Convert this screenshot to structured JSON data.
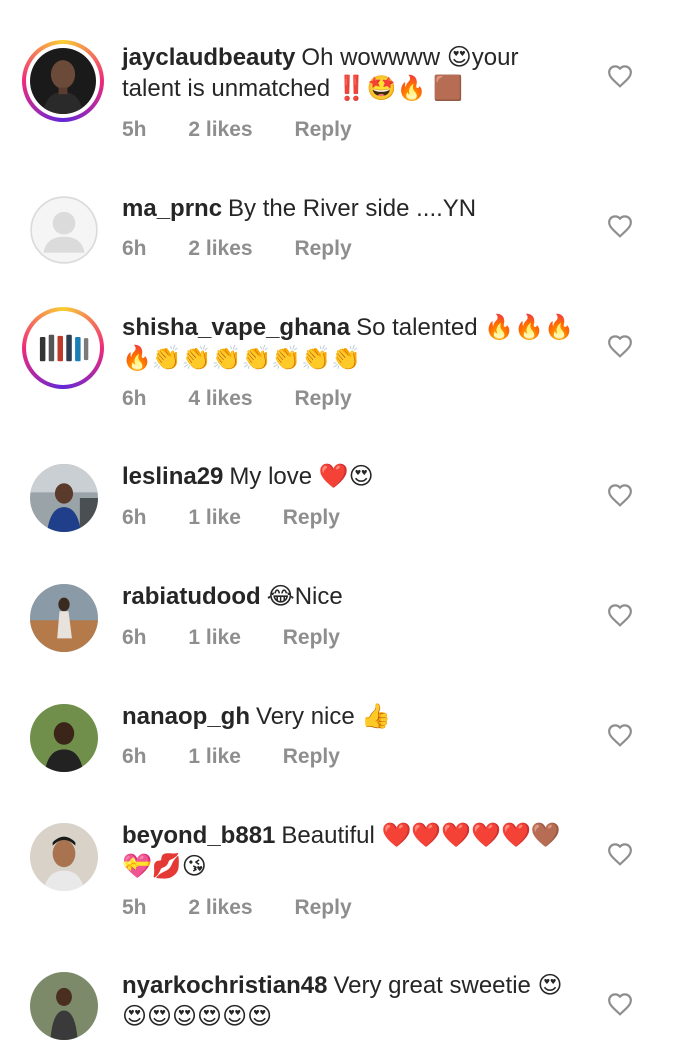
{
  "comments": [
    {
      "username": "jayclaudbeauty",
      "text": "Oh wowwww 😍your talent is unmatched ‼️🤩🔥 🟫",
      "time": "5h",
      "likes": "2 likes",
      "reply": "Reply",
      "avatar_icon": "avatar-photo-man",
      "story_ring": true
    },
    {
      "username": "ma_prnc",
      "text": "By the River side ....YN",
      "time": "6h",
      "likes": "2 likes",
      "reply": "Reply",
      "avatar_icon": "default-avatar-icon",
      "story_ring": false
    },
    {
      "username": "shisha_vape_ghana",
      "text": "So talented 🔥🔥🔥🔥👏👏👏👏👏👏👏",
      "time": "6h",
      "likes": "4 likes",
      "reply": "Reply",
      "avatar_icon": "avatar-vape-products",
      "story_ring": true
    },
    {
      "username": "leslina29",
      "text": "My love ❤️😍",
      "time": "6h",
      "likes": "1 like",
      "reply": "Reply",
      "avatar_icon": "avatar-photo-woman-car",
      "story_ring": false
    },
    {
      "username": "rabiatudood",
      "text": "😂Nice",
      "time": "6h",
      "likes": "1 like",
      "reply": "Reply",
      "avatar_icon": "avatar-photo-woman-outdoor",
      "story_ring": false
    },
    {
      "username": "nanaop_gh",
      "text": "Very nice 👍",
      "time": "6h",
      "likes": "1 like",
      "reply": "Reply",
      "avatar_icon": "avatar-photo-woman-greenery",
      "story_ring": false
    },
    {
      "username": "beyond_b881",
      "text": "Beautiful ❤️❤️❤️❤️❤️🤎💝💋😘",
      "time": "5h",
      "likes": "2 likes",
      "reply": "Reply",
      "avatar_icon": "avatar-photo-man-young",
      "story_ring": false
    },
    {
      "username": "nyarkochristian48",
      "text": "Very great sweetie 😍😍😍😍😍😍😍",
      "time": "",
      "likes": "",
      "reply": "",
      "avatar_icon": "avatar-photo-man-outdoor",
      "story_ring": false
    }
  ],
  "colors": {
    "text": "#262626",
    "meta": "#8e8e8e",
    "heart_outline": "#8e8e8e"
  }
}
